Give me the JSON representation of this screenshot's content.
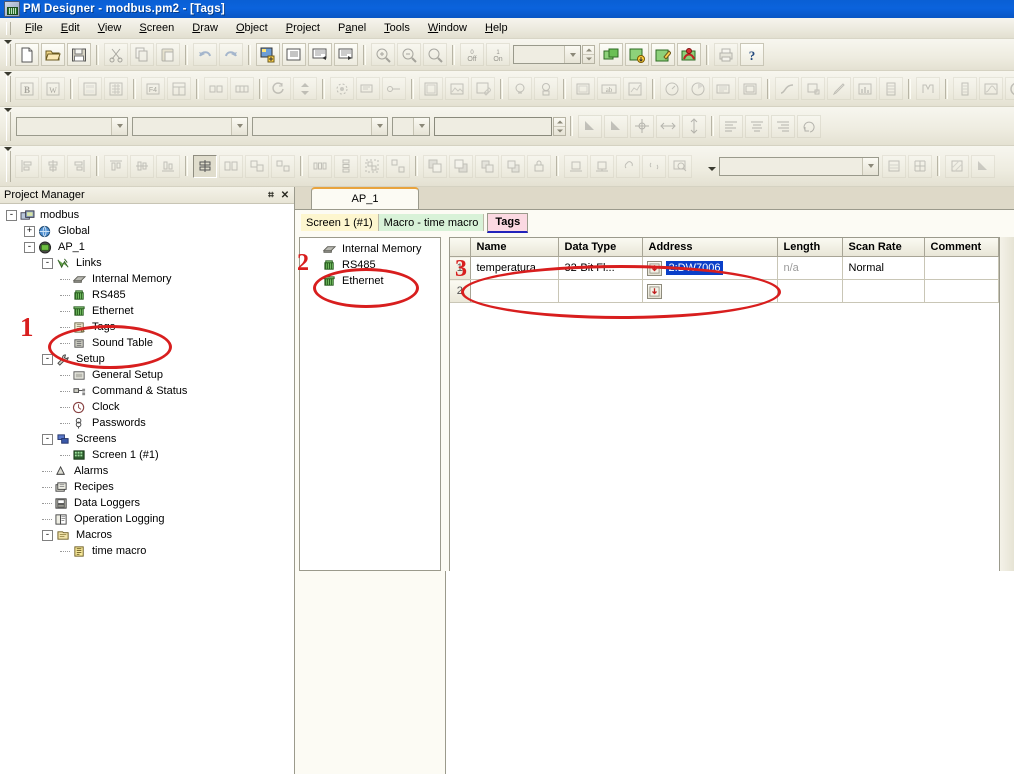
{
  "window": {
    "title": "PM Designer - modbus.pm2 - [Tags]",
    "app_icon": "pm-designer-icon"
  },
  "menubar": {
    "items": [
      {
        "label": "File",
        "accel": "F"
      },
      {
        "label": "Edit",
        "accel": "E"
      },
      {
        "label": "View",
        "accel": "V"
      },
      {
        "label": "Screen",
        "accel": "S"
      },
      {
        "label": "Draw",
        "accel": "D"
      },
      {
        "label": "Object",
        "accel": "O"
      },
      {
        "label": "Project",
        "accel": "P"
      },
      {
        "label": "Panel",
        "accel": "a"
      },
      {
        "label": "Tools",
        "accel": "T"
      },
      {
        "label": "Window",
        "accel": "W"
      },
      {
        "label": "Help",
        "accel": "H"
      }
    ]
  },
  "toolbar_standard": {
    "buttons": [
      {
        "name": "new-file-icon",
        "enabled": true
      },
      {
        "name": "open-folder-icon",
        "enabled": true
      },
      {
        "name": "save-disk-icon",
        "enabled": true
      },
      {
        "name": "cut-scissors-icon",
        "enabled": false
      },
      {
        "name": "copy-icon",
        "enabled": false
      },
      {
        "name": "paste-icon",
        "enabled": false
      },
      {
        "name": "undo-icon",
        "enabled": false
      },
      {
        "name": "redo-icon",
        "enabled": false
      },
      {
        "name": "new-screen-icon",
        "enabled": true
      },
      {
        "name": "screen-list-icon",
        "enabled": true
      },
      {
        "name": "screen-prev-icon",
        "enabled": true
      },
      {
        "name": "screen-next-icon",
        "enabled": true
      },
      {
        "name": "zoom-in-icon",
        "enabled": false
      },
      {
        "name": "zoom-out-icon",
        "enabled": false
      },
      {
        "name": "zoom-fit-icon",
        "enabled": false
      },
      {
        "name": "state-off-icon",
        "enabled": false,
        "label": "0 Off"
      },
      {
        "name": "state-on-icon",
        "enabled": false,
        "label": "1 On"
      },
      {
        "name": "compile-icon",
        "enabled": true
      },
      {
        "name": "download-icon",
        "enabled": true
      },
      {
        "name": "simulate-icon",
        "enabled": true
      },
      {
        "name": "online-sim-icon",
        "enabled": true
      },
      {
        "name": "print-icon",
        "enabled": false
      },
      {
        "name": "help-question-icon",
        "enabled": true
      }
    ],
    "state_combo_value": "",
    "state_combo_placeholder": ""
  },
  "toolbar_objects": {
    "buttons": [
      {
        "name": "button-object-icon"
      },
      {
        "name": "set-object-icon"
      },
      {
        "name": "keypad-object-icon"
      },
      {
        "name": "numeric-keypad-icon"
      },
      {
        "name": "numeric-entry-icon"
      },
      {
        "name": "table-object-icon"
      },
      {
        "name": "toggle-switch-icon"
      },
      {
        "name": "slide-switch-icon"
      },
      {
        "name": "rotary-icon"
      },
      {
        "name": "updown-arrows-icon"
      },
      {
        "name": "animation-icon"
      },
      {
        "name": "message-display-icon"
      },
      {
        "name": "link-object-icon"
      },
      {
        "name": "window-object-icon"
      },
      {
        "name": "picture-object-icon"
      },
      {
        "name": "picture-edit-icon"
      },
      {
        "name": "indicator-lamp-icon"
      },
      {
        "name": "pilot-lamp-icon"
      },
      {
        "name": "frame-object-icon"
      },
      {
        "name": "ab-text-icon"
      },
      {
        "name": "chart-object-icon"
      },
      {
        "name": "meter-gauge-icon"
      },
      {
        "name": "pie-graph-icon"
      },
      {
        "name": "history-display-icon"
      },
      {
        "name": "box-display-icon"
      },
      {
        "name": "pipe-icon"
      },
      {
        "name": "rectangle-select-icon"
      },
      {
        "name": "pencil-icon"
      },
      {
        "name": "bar-graph-icon"
      },
      {
        "name": "film-strip-icon"
      },
      {
        "name": "macro-object-icon"
      },
      {
        "name": "thermometer-icon"
      },
      {
        "name": "trend-graph-icon"
      },
      {
        "name": "round-meter-icon"
      }
    ]
  },
  "toolbar_format": {
    "combo1_value": "",
    "combo2_value": "",
    "combo3_value": "",
    "combo4_value": "",
    "text_value": "",
    "buttons": [
      {
        "name": "fill-color-icon"
      },
      {
        "name": "line-color-icon"
      },
      {
        "name": "center-crosshair-icon"
      },
      {
        "name": "flip-horizontal-icon"
      },
      {
        "name": "flip-vertical-icon"
      },
      {
        "name": "align-left-icon"
      },
      {
        "name": "align-center-icon"
      },
      {
        "name": "align-right-icon"
      },
      {
        "name": "rotate-icon"
      }
    ]
  },
  "toolbar_align": {
    "buttons": [
      {
        "name": "align-edge-left-icon"
      },
      {
        "name": "align-edge-center-icon"
      },
      {
        "name": "align-edge-right-icon"
      },
      {
        "name": "align-top-icon"
      },
      {
        "name": "align-middle-icon"
      },
      {
        "name": "align-bottom-icon"
      },
      {
        "name": "same-width-icon"
      },
      {
        "name": "same-height-icon"
      },
      {
        "name": "same-size-icon"
      },
      {
        "name": "space-equal-icon"
      },
      {
        "name": "distribute-h-icon"
      },
      {
        "name": "distribute-v-icon"
      },
      {
        "name": "group-icon"
      },
      {
        "name": "ungroup-icon"
      },
      {
        "name": "bring-front-icon"
      },
      {
        "name": "send-back-icon"
      },
      {
        "name": "bring-forward-icon"
      },
      {
        "name": "send-backward-icon"
      },
      {
        "name": "lock-position-icon"
      },
      {
        "name": "nudge-left-icon"
      },
      {
        "name": "nudge-right-icon"
      },
      {
        "name": "link-chain-icon"
      },
      {
        "name": "unlink-icon"
      },
      {
        "name": "zoom-region-icon"
      }
    ],
    "combo_value": "",
    "right_buttons": [
      {
        "name": "pattern-icon"
      },
      {
        "name": "grid-snap-icon"
      },
      {
        "name": "hatch-fill-icon"
      },
      {
        "name": "fill-style-icon"
      }
    ]
  },
  "project_manager": {
    "title": "Project Manager",
    "pin_icon": "pin-icon",
    "close_icon": "close-icon",
    "tree": [
      {
        "label": "modbus",
        "depth": 0,
        "expander": "-",
        "icon": "project-icon"
      },
      {
        "label": "Global",
        "depth": 1,
        "expander": "+",
        "icon": "globe-icon"
      },
      {
        "label": "AP_1",
        "depth": 1,
        "expander": "-",
        "icon": "panel-icon"
      },
      {
        "label": "Links",
        "depth": 2,
        "expander": "-",
        "icon": "links-icon"
      },
      {
        "label": "Internal Memory",
        "depth": 3,
        "expander": "",
        "icon": "memory-chip-icon"
      },
      {
        "label": "RS485",
        "depth": 3,
        "expander": "",
        "icon": "serial-port-icon"
      },
      {
        "label": "Ethernet",
        "depth": 3,
        "expander": "",
        "icon": "ethernet-icon"
      },
      {
        "label": "Tags",
        "depth": 3,
        "expander": "",
        "icon": "tags-icon"
      },
      {
        "label": "Sound Table",
        "depth": 3,
        "expander": "",
        "icon": "sound-icon"
      },
      {
        "label": "Setup",
        "depth": 2,
        "expander": "-",
        "icon": "wrench-icon"
      },
      {
        "label": "General Setup",
        "depth": 3,
        "expander": "",
        "icon": "general-setup-icon"
      },
      {
        "label": "Command & Status",
        "depth": 3,
        "expander": "",
        "icon": "command-status-icon"
      },
      {
        "label": "Clock",
        "depth": 3,
        "expander": "",
        "icon": "clock-icon"
      },
      {
        "label": "Passwords",
        "depth": 3,
        "expander": "",
        "icon": "password-key-icon"
      },
      {
        "label": "Screens",
        "depth": 2,
        "expander": "-",
        "icon": "screens-icon"
      },
      {
        "label": "Screen 1 (#1)",
        "depth": 3,
        "expander": "",
        "icon": "screen-icon"
      },
      {
        "label": "Alarms",
        "depth": 2,
        "expander": "",
        "icon": "alarm-bell-icon"
      },
      {
        "label": "Recipes",
        "depth": 2,
        "expander": "",
        "icon": "recipes-icon"
      },
      {
        "label": "Data Loggers",
        "depth": 2,
        "expander": "",
        "icon": "data-logger-icon"
      },
      {
        "label": "Operation Logging",
        "depth": 2,
        "expander": "",
        "icon": "operation-log-icon"
      },
      {
        "label": "Macros",
        "depth": 2,
        "expander": "-",
        "icon": "macros-folder-icon"
      },
      {
        "label": "time macro",
        "depth": 3,
        "expander": "",
        "icon": "macro-file-icon"
      }
    ]
  },
  "document": {
    "tab": "AP_1",
    "subtabs": [
      {
        "label": "Screen 1 (#1)",
        "active": false,
        "color": "#fdf6cf"
      },
      {
        "label": "Macro - time macro",
        "active": false,
        "color": "#d8f2d8"
      },
      {
        "label": "Tags",
        "active": true,
        "color": "#fbd9e2"
      }
    ]
  },
  "link_pane": {
    "items": [
      {
        "label": "Internal Memory",
        "icon": "memory-chip-icon",
        "selected": false
      },
      {
        "label": "RS485",
        "icon": "serial-port-icon",
        "selected": true
      },
      {
        "label": "Ethernet",
        "icon": "ethernet-icon",
        "selected": false
      }
    ]
  },
  "tag_grid": {
    "columns": [
      "Name",
      "Data Type",
      "Address",
      "Length",
      "Scan Rate",
      "Comment"
    ],
    "rows": [
      {
        "num": "1",
        "name": "temperatura",
        "data_type": "32-Bit Fl...",
        "address": "2:DW7006",
        "address_selected": true,
        "address_button_icon": "address-picker-icon",
        "length": "n/a",
        "scan_rate": "Normal",
        "comment": ""
      },
      {
        "num": "2",
        "name": "",
        "data_type": "",
        "address": "",
        "address_selected": false,
        "address_button_icon": "address-picker-icon",
        "length": "",
        "scan_rate": "",
        "comment": ""
      }
    ]
  },
  "annotations": {
    "color": "#d81e1e",
    "markers": [
      {
        "number": "1",
        "target": "tree-item-tags"
      },
      {
        "number": "2",
        "target": "link-item-rs485"
      },
      {
        "number": "3",
        "target": "tag-grid-row-1"
      }
    ]
  }
}
